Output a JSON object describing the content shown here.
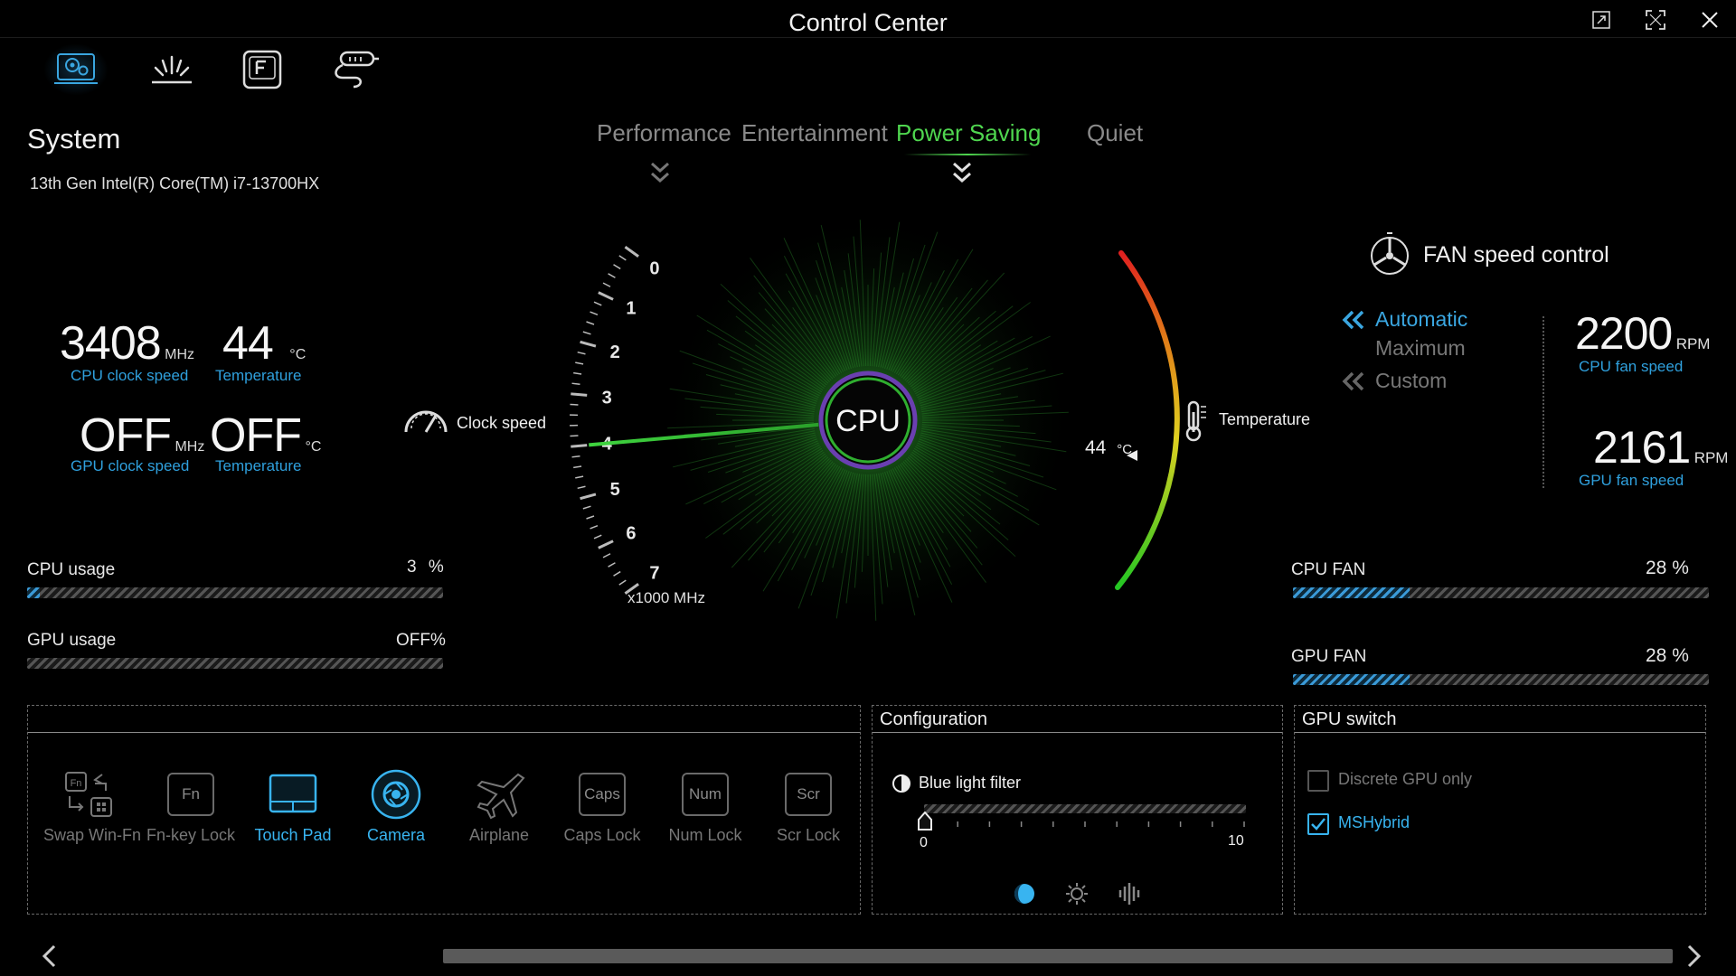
{
  "app": {
    "title": "Control Center"
  },
  "nav": {
    "tabs": [
      "system-settings-icon",
      "lighting-icon",
      "function-key-icon",
      "cable-connection-icon"
    ],
    "active": 0
  },
  "system": {
    "title": "System",
    "cpu_name": "13th Gen Intel(R) Core(TM) i7-13700HX",
    "cpu_clock": "3408",
    "cpu_clock_unit": "MHz",
    "cpu_clock_label": "CPU clock speed",
    "cpu_temp": "44",
    "cpu_temp_unit": "°C",
    "cpu_temp_label": "Temperature",
    "gpu_clock": "OFF",
    "gpu_clock_unit": "MHz",
    "gpu_clock_label": "GPU clock speed",
    "gpu_temp": "OFF",
    "gpu_temp_unit": "°C",
    "gpu_temp_label": "Temperature"
  },
  "usage": {
    "cpu_label": "CPU usage",
    "cpu_value": "3",
    "cpu_unit": "%",
    "cpu_fraction": 0.03,
    "gpu_label": "GPU usage",
    "gpu_value": "OFF",
    "gpu_unit": "%",
    "gpu_fraction": 0
  },
  "modes": {
    "items": [
      "Performance",
      "Entertainment",
      "Power Saving",
      "Quiet"
    ],
    "active": "Power Saving"
  },
  "gauge": {
    "center_label": "CPU",
    "clock_label": "Clock speed",
    "ticks": [
      "7",
      "6",
      "5",
      "4",
      "3",
      "2",
      "1",
      "0"
    ],
    "scale_unit": "x1000 MHz",
    "needle_value": 4,
    "temp_label": "Temperature",
    "temp_value": "44",
    "temp_unit": "°C"
  },
  "fan": {
    "title": "FAN speed control",
    "modes": [
      "Automatic",
      "Maximum",
      "Custom"
    ],
    "active_mode": "Automatic",
    "cpu_rpm": "2200",
    "rpm_unit": "RPM",
    "cpu_rpm_label": "CPU fan speed",
    "gpu_rpm": "2161",
    "gpu_rpm_label": "GPU fan speed",
    "cpu_fan_label": "CPU FAN",
    "cpu_fan_value": "28",
    "cpu_fan_unit": "%",
    "cpu_fan_fraction": 0.28,
    "gpu_fan_label": "GPU FAN",
    "gpu_fan_value": "28",
    "gpu_fan_unit": "%",
    "gpu_fan_fraction": 0.28
  },
  "quick_keys": [
    {
      "label": "Swap Win-Fn",
      "icon": "swap-win-fn-icon",
      "on": false
    },
    {
      "label": "Fn-key Lock",
      "icon": "fn-key-lock-icon",
      "keycap": "Fn",
      "on": false
    },
    {
      "label": "Touch Pad",
      "icon": "touchpad-icon",
      "on": true
    },
    {
      "label": "Camera",
      "icon": "camera-icon",
      "on": true
    },
    {
      "label": "Airplane",
      "icon": "airplane-icon",
      "on": false
    },
    {
      "label": "Caps Lock",
      "icon": "caps-lock-icon",
      "keycap": "Caps",
      "on": false
    },
    {
      "label": "Num Lock",
      "icon": "num-lock-icon",
      "keycap": "Num",
      "on": false
    },
    {
      "label": "Scr Lock",
      "icon": "scroll-lock-icon",
      "keycap": "Scr",
      "on": false
    }
  ],
  "configuration": {
    "title": "Configuration",
    "blue_light_label": "Blue light filter",
    "slider_min": "0",
    "slider_max": "10",
    "slider_value": 0,
    "bottom_icons": [
      "blue-light-icon",
      "brightness-icon",
      "audio-wave-icon"
    ]
  },
  "gpu_switch": {
    "title": "GPU switch",
    "options": [
      {
        "label": "Discrete GPU only",
        "checked": false
      },
      {
        "label": "MSHybrid",
        "checked": true
      }
    ]
  },
  "colors": {
    "accent": "#38b4f0",
    "mode_active": "#4fd64f",
    "gauge_glow": "#3fd43f"
  }
}
